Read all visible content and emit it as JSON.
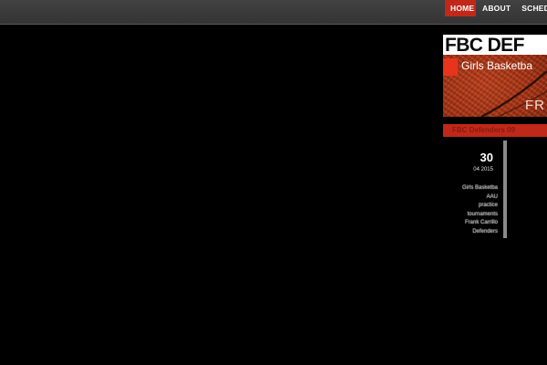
{
  "nav": {
    "items": [
      {
        "label": "HOME",
        "active": true
      },
      {
        "label": "ABOUT",
        "active": false
      },
      {
        "label": "SCHED",
        "active": false
      }
    ]
  },
  "banner": {
    "title": "FBC DEF",
    "subtitle": "Girls Basketba",
    "tag": "FR"
  },
  "section": {
    "title": "FBC Defenders 09"
  },
  "post": {
    "day": "30",
    "date": "04 2015",
    "excerpt": [
      "Girls Basketba",
      "AAU",
      "practice",
      "tournaments",
      "Frank Carrillo",
      "Defenders"
    ]
  },
  "colors": {
    "accent": "#c0281a",
    "topbar": "#3a3a3a",
    "background": "#000000"
  }
}
